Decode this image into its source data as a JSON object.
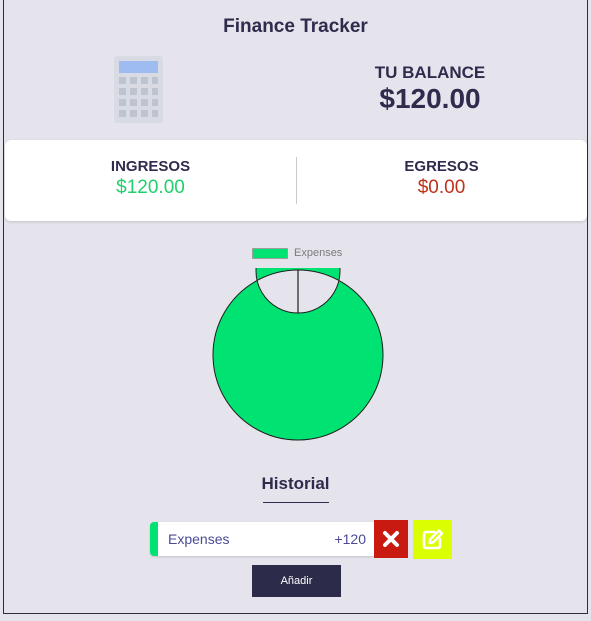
{
  "app": {
    "title": "Finance Tracker"
  },
  "balance": {
    "label": "TU BALANCE",
    "amount": "$120.00"
  },
  "summary": {
    "income_label": "INGRESOS",
    "income_value": "$120.00",
    "expense_label": "EGRESOS",
    "expense_value": "$0.00"
  },
  "chart_data": {
    "type": "pie",
    "categories": [
      "Expenses"
    ],
    "values": [
      120
    ],
    "colors": [
      "#00e272"
    ],
    "legend": "top",
    "title": ""
  },
  "history": {
    "title": "Historial",
    "entries": [
      {
        "name": "Expenses",
        "amount": "+120",
        "color": "#00e272"
      }
    ],
    "add_label": "Añadir"
  },
  "icons": {
    "calculator": "calculator-icon",
    "delete": "close-icon",
    "edit": "edit-icon"
  }
}
